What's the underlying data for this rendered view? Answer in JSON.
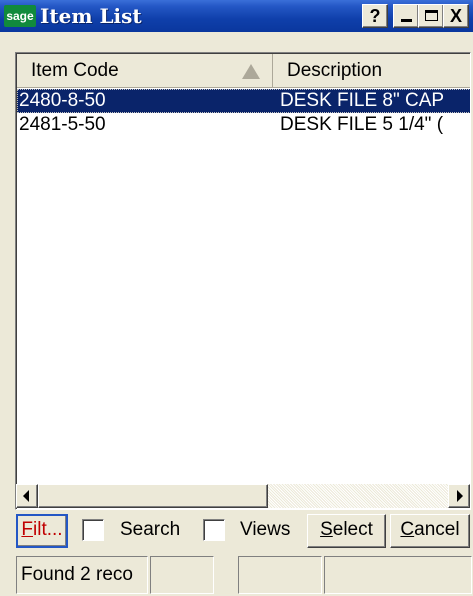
{
  "window": {
    "logo_text": "sage",
    "title": "Item List",
    "help_label": "?",
    "close_label": "X"
  },
  "columns": [
    {
      "label": "Item Code",
      "sorted": "ascending"
    },
    {
      "label": "Description"
    }
  ],
  "rows": [
    {
      "code": "2480-8-50",
      "description": "DESK FILE 8\" CAP",
      "selected": true
    },
    {
      "code": "2481-5-50",
      "description": "DESK FILE 5 1/4\" (",
      "selected": false
    }
  ],
  "toolbar": {
    "filter_label_underlined": "F",
    "filter_label_rest": "ilt...",
    "search_label": "Search",
    "search_checked": false,
    "views_label": "Views",
    "views_checked": false,
    "select_underlined": "S",
    "select_rest": "elect",
    "cancel_underlined": "C",
    "cancel_rest": "ancel"
  },
  "status": {
    "message": "Found 2 reco"
  },
  "colors": {
    "titlebar": "#0a379e",
    "selection": "#0a246a",
    "filter_text": "#c00000",
    "logo": "#118a3c"
  }
}
